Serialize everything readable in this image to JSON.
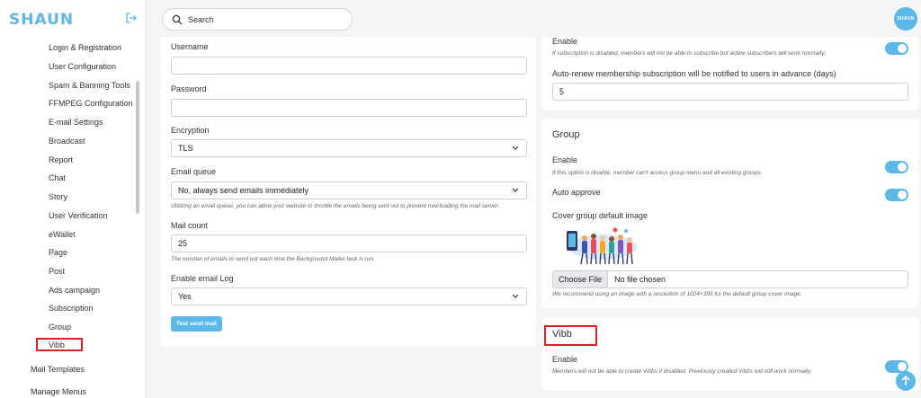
{
  "sidebar": {
    "logo": "SHAUN",
    "items": [
      {
        "label": "Login & Registration"
      },
      {
        "label": "User Configuration"
      },
      {
        "label": "Spam & Banning Tools"
      },
      {
        "label": "FFMPEG Configuration"
      },
      {
        "label": "E-mail Settings"
      },
      {
        "label": "Broadcast"
      },
      {
        "label": "Report"
      },
      {
        "label": "Chat"
      },
      {
        "label": "Story"
      },
      {
        "label": "User Verification"
      },
      {
        "label": "eWallet"
      },
      {
        "label": "Page"
      },
      {
        "label": "Post"
      },
      {
        "label": "Ads campaign"
      },
      {
        "label": "Subscription"
      },
      {
        "label": "Group"
      },
      {
        "label": "Vibb"
      }
    ],
    "top_items": [
      {
        "label": "Mail Templates"
      },
      {
        "label": "Manage Menus"
      }
    ]
  },
  "topbar": {
    "search_placeholder": "Search",
    "avatar_text": "SHAUN"
  },
  "mail": {
    "username_label": "Username",
    "username_value": "",
    "password_label": "Password",
    "password_value": "",
    "encryption_label": "Encryption",
    "encryption_value": "TLS",
    "queue_label": "Email queue",
    "queue_value": "No, always send emails immediately",
    "queue_help": "Utilizing an email queue, you can allow your website to throttle the emails being sent out to prevent overloading the mail server.",
    "count_label": "Mail count",
    "count_value": "25",
    "count_help": "The number of emails to send out each time the Background Mailer task is run.",
    "log_label": "Enable email Log",
    "log_value": "Yes",
    "test_button": "Test send mail"
  },
  "subscription": {
    "enable_label": "Enable",
    "enable_help": "If subscription is disabled, members will not be able to subscribe but active subscribers will work normally.",
    "enable_on": true,
    "renew_label": "Auto-renew membership subscription will be notified to users in advance (days)",
    "renew_value": "5"
  },
  "group": {
    "title": "Group",
    "enable_label": "Enable",
    "enable_help": "If this option is disable, member can't access group menu and all existing groups.",
    "enable_on": true,
    "approve_label": "Auto approve",
    "approve_on": true,
    "cover_label": "Cover group default image",
    "choose_file": "Choose File",
    "no_file": "No file chosen",
    "cover_help": "We recommend using an image with a resolution of 1024×395 for the default group cover image."
  },
  "vibb": {
    "title": "Vibb",
    "enable_label": "Enable",
    "enable_help": "Members will not be able to create Vibbs if disabled. Previously created Vibbs will still work normally.",
    "enable_on": true
  },
  "colors": {
    "accent": "#5bb8e8",
    "highlight": "#e02020"
  }
}
